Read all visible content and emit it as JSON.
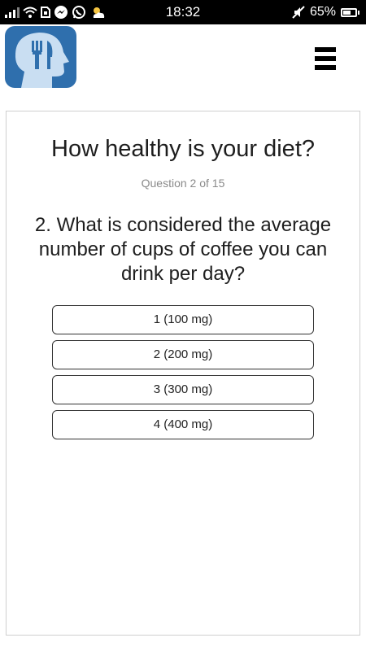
{
  "status_bar": {
    "time": "18:32",
    "battery_percent": "65%",
    "battery_level": 0.65,
    "icons": [
      "signal-icon",
      "wifi-icon",
      "sim-icon",
      "messenger-icon",
      "whatsapp-icon",
      "weather-icon",
      "mute-icon",
      "battery-icon"
    ]
  },
  "header": {
    "logo": "head-fork-knife-logo",
    "menu_icon": "hamburger-menu-icon"
  },
  "quiz": {
    "title": "How healthy is your diet?",
    "progress": "Question 2 of 15",
    "question": "2. What is considered the average number of cups of coffee you can drink per day?",
    "answers": [
      "1 (100 mg)",
      "2 (200 mg)",
      "3 (300 mg)",
      "4 (400 mg)"
    ]
  },
  "colors": {
    "logo_background": "#2f6fad",
    "logo_head": "#c9def2",
    "status_bar": "#000000"
  }
}
